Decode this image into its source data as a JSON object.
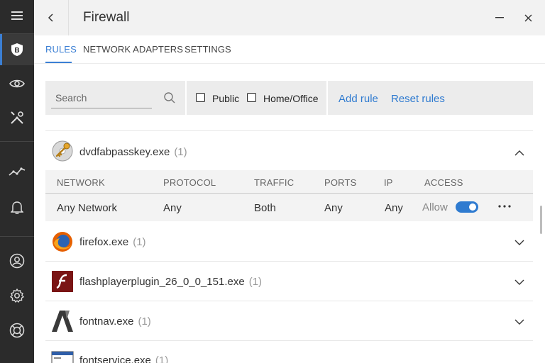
{
  "window": {
    "title": "Firewall"
  },
  "rail": {
    "items": [
      "menu-icon",
      "brand-shield-icon",
      "eye-icon",
      "tools-icon",
      "activity-icon",
      "bell-icon",
      "account-icon",
      "gear-icon",
      "lifebuoy-icon"
    ],
    "brand_letter": "B"
  },
  "tabs": [
    {
      "label": "RULES",
      "active": true
    },
    {
      "label": "NETWORK ADAPTERS",
      "active": false
    },
    {
      "label": "SETTINGS",
      "active": false
    }
  ],
  "toolbar": {
    "search_placeholder": "Search",
    "checkboxes": [
      {
        "label": "Public",
        "checked": false
      },
      {
        "label": "Home/Office",
        "checked": false
      }
    ],
    "add_rule": "Add rule",
    "reset_rules": "Reset rules"
  },
  "apps": [
    {
      "name": "dvdfabpasskey.exe",
      "count": "(1)",
      "expanded": true,
      "icon": "key-disc-icon"
    },
    {
      "name": "firefox.exe",
      "count": "(1)",
      "expanded": false,
      "icon": "firefox-icon"
    },
    {
      "name": "flashplayerplugin_26_0_0_151.exe",
      "count": "(1)",
      "expanded": false,
      "icon": "flash-icon"
    },
    {
      "name": "fontnav.exe",
      "count": "(1)",
      "expanded": false,
      "icon": "fontnav-icon"
    },
    {
      "name": "fontservice.exe",
      "count": "(1)",
      "expanded": false,
      "icon": "window-app-icon"
    }
  ],
  "rule_table": {
    "headers": [
      "NETWORK",
      "PROTOCOL",
      "TRAFFIC",
      "PORTS",
      "IP",
      "ACCESS"
    ],
    "row": {
      "network": "Any Network",
      "protocol": "Any",
      "traffic": "Both",
      "ports": "Any",
      "ip": "Any",
      "access": "Allow",
      "access_enabled": true
    }
  },
  "colors": {
    "accent": "#2f7bd0",
    "rail_bg": "#2b2b2b"
  }
}
